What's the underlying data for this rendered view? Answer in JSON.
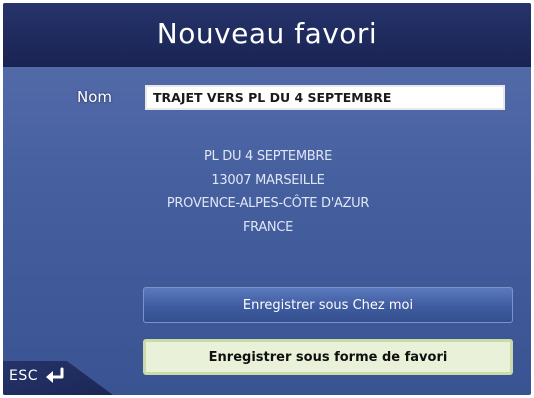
{
  "title": "Nouveau favori",
  "name_field": {
    "label": "Nom",
    "value": "TRAJET VERS PL DU 4 SEPTEMBRE"
  },
  "address": {
    "lines": [
      "PL DU 4 SEPTEMBRE",
      "13007 MARSEILLE",
      "PROVENCE-ALPES-CÔTE D'AZUR",
      "FRANCE"
    ]
  },
  "buttons": {
    "save_home": "Enregistrer sous Chez moi",
    "save_favorite": "Enregistrer sous forme de favori"
  },
  "footer": {
    "esc_label": "ESC",
    "back_icon": "back-arrow-icon"
  },
  "colors": {
    "title_bar": "#1e2a5c",
    "background": "#4a63a3",
    "selected_button": "#e9f2d8"
  }
}
